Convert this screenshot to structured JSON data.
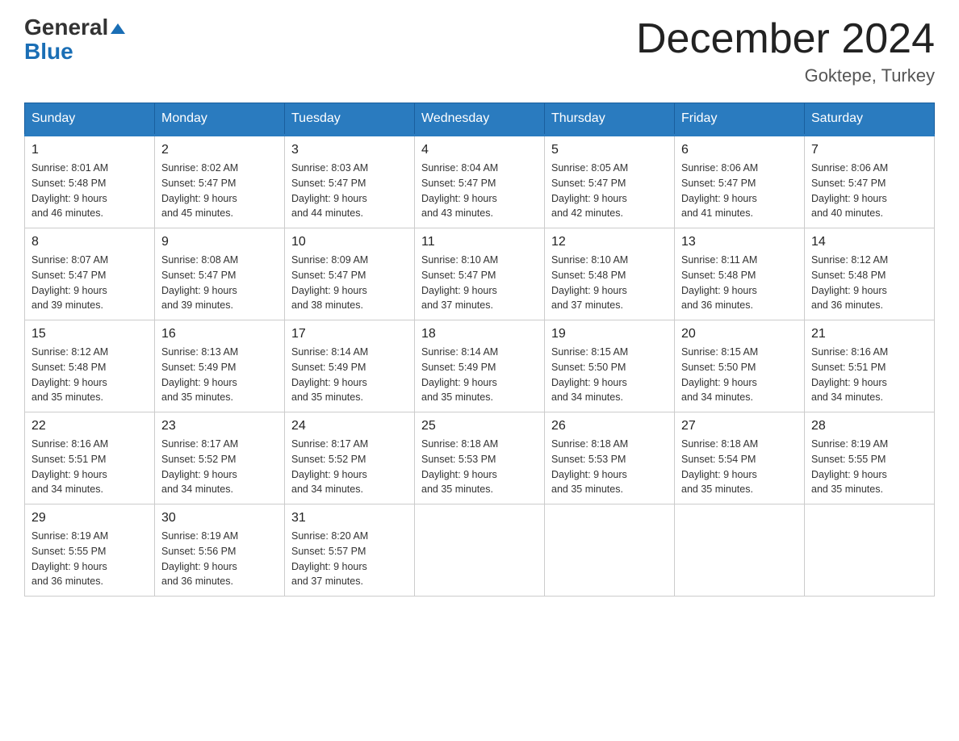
{
  "header": {
    "logo_line1": "General",
    "logo_line2": "Blue",
    "month_title": "December 2024",
    "location": "Goktepe, Turkey"
  },
  "weekdays": [
    "Sunday",
    "Monday",
    "Tuesday",
    "Wednesday",
    "Thursday",
    "Friday",
    "Saturday"
  ],
  "weeks": [
    [
      {
        "day": "1",
        "info": "Sunrise: 8:01 AM\nSunset: 5:48 PM\nDaylight: 9 hours\nand 46 minutes."
      },
      {
        "day": "2",
        "info": "Sunrise: 8:02 AM\nSunset: 5:47 PM\nDaylight: 9 hours\nand 45 minutes."
      },
      {
        "day": "3",
        "info": "Sunrise: 8:03 AM\nSunset: 5:47 PM\nDaylight: 9 hours\nand 44 minutes."
      },
      {
        "day": "4",
        "info": "Sunrise: 8:04 AM\nSunset: 5:47 PM\nDaylight: 9 hours\nand 43 minutes."
      },
      {
        "day": "5",
        "info": "Sunrise: 8:05 AM\nSunset: 5:47 PM\nDaylight: 9 hours\nand 42 minutes."
      },
      {
        "day": "6",
        "info": "Sunrise: 8:06 AM\nSunset: 5:47 PM\nDaylight: 9 hours\nand 41 minutes."
      },
      {
        "day": "7",
        "info": "Sunrise: 8:06 AM\nSunset: 5:47 PM\nDaylight: 9 hours\nand 40 minutes."
      }
    ],
    [
      {
        "day": "8",
        "info": "Sunrise: 8:07 AM\nSunset: 5:47 PM\nDaylight: 9 hours\nand 39 minutes."
      },
      {
        "day": "9",
        "info": "Sunrise: 8:08 AM\nSunset: 5:47 PM\nDaylight: 9 hours\nand 39 minutes."
      },
      {
        "day": "10",
        "info": "Sunrise: 8:09 AM\nSunset: 5:47 PM\nDaylight: 9 hours\nand 38 minutes."
      },
      {
        "day": "11",
        "info": "Sunrise: 8:10 AM\nSunset: 5:47 PM\nDaylight: 9 hours\nand 37 minutes."
      },
      {
        "day": "12",
        "info": "Sunrise: 8:10 AM\nSunset: 5:48 PM\nDaylight: 9 hours\nand 37 minutes."
      },
      {
        "day": "13",
        "info": "Sunrise: 8:11 AM\nSunset: 5:48 PM\nDaylight: 9 hours\nand 36 minutes."
      },
      {
        "day": "14",
        "info": "Sunrise: 8:12 AM\nSunset: 5:48 PM\nDaylight: 9 hours\nand 36 minutes."
      }
    ],
    [
      {
        "day": "15",
        "info": "Sunrise: 8:12 AM\nSunset: 5:48 PM\nDaylight: 9 hours\nand 35 minutes."
      },
      {
        "day": "16",
        "info": "Sunrise: 8:13 AM\nSunset: 5:49 PM\nDaylight: 9 hours\nand 35 minutes."
      },
      {
        "day": "17",
        "info": "Sunrise: 8:14 AM\nSunset: 5:49 PM\nDaylight: 9 hours\nand 35 minutes."
      },
      {
        "day": "18",
        "info": "Sunrise: 8:14 AM\nSunset: 5:49 PM\nDaylight: 9 hours\nand 35 minutes."
      },
      {
        "day": "19",
        "info": "Sunrise: 8:15 AM\nSunset: 5:50 PM\nDaylight: 9 hours\nand 34 minutes."
      },
      {
        "day": "20",
        "info": "Sunrise: 8:15 AM\nSunset: 5:50 PM\nDaylight: 9 hours\nand 34 minutes."
      },
      {
        "day": "21",
        "info": "Sunrise: 8:16 AM\nSunset: 5:51 PM\nDaylight: 9 hours\nand 34 minutes."
      }
    ],
    [
      {
        "day": "22",
        "info": "Sunrise: 8:16 AM\nSunset: 5:51 PM\nDaylight: 9 hours\nand 34 minutes."
      },
      {
        "day": "23",
        "info": "Sunrise: 8:17 AM\nSunset: 5:52 PM\nDaylight: 9 hours\nand 34 minutes."
      },
      {
        "day": "24",
        "info": "Sunrise: 8:17 AM\nSunset: 5:52 PM\nDaylight: 9 hours\nand 34 minutes."
      },
      {
        "day": "25",
        "info": "Sunrise: 8:18 AM\nSunset: 5:53 PM\nDaylight: 9 hours\nand 35 minutes."
      },
      {
        "day": "26",
        "info": "Sunrise: 8:18 AM\nSunset: 5:53 PM\nDaylight: 9 hours\nand 35 minutes."
      },
      {
        "day": "27",
        "info": "Sunrise: 8:18 AM\nSunset: 5:54 PM\nDaylight: 9 hours\nand 35 minutes."
      },
      {
        "day": "28",
        "info": "Sunrise: 8:19 AM\nSunset: 5:55 PM\nDaylight: 9 hours\nand 35 minutes."
      }
    ],
    [
      {
        "day": "29",
        "info": "Sunrise: 8:19 AM\nSunset: 5:55 PM\nDaylight: 9 hours\nand 36 minutes."
      },
      {
        "day": "30",
        "info": "Sunrise: 8:19 AM\nSunset: 5:56 PM\nDaylight: 9 hours\nand 36 minutes."
      },
      {
        "day": "31",
        "info": "Sunrise: 8:20 AM\nSunset: 5:57 PM\nDaylight: 9 hours\nand 37 minutes."
      },
      {
        "day": "",
        "info": ""
      },
      {
        "day": "",
        "info": ""
      },
      {
        "day": "",
        "info": ""
      },
      {
        "day": "",
        "info": ""
      }
    ]
  ]
}
